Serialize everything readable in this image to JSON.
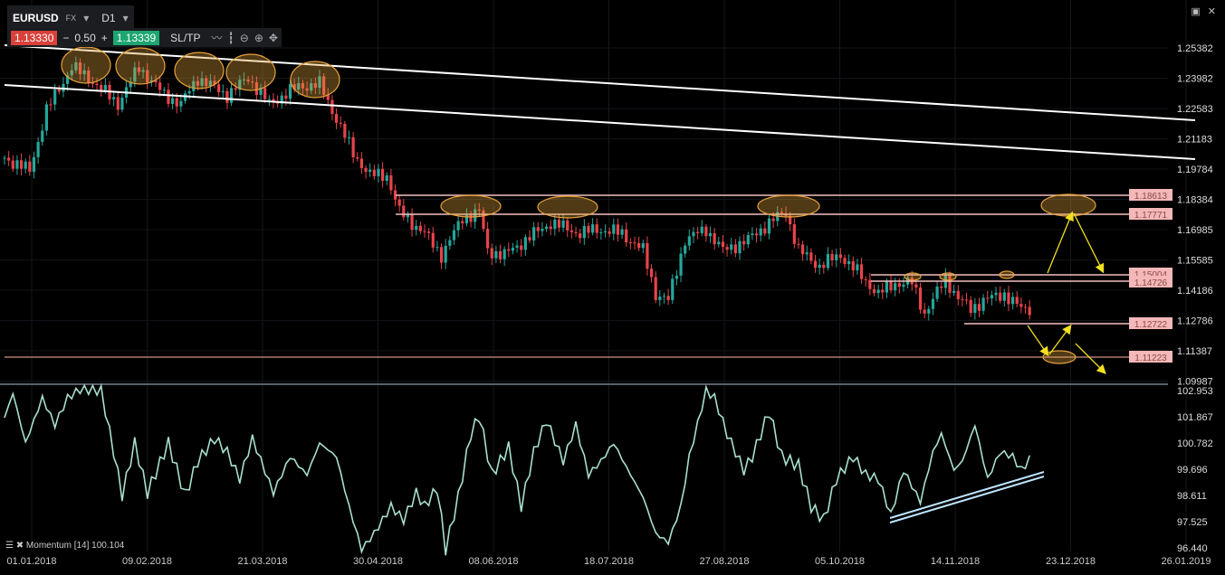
{
  "header": {
    "symbol": "EURUSD",
    "market": "FX",
    "timeframe": "D1",
    "bid": "1.13330",
    "spread_minus": "−",
    "spread": "0.50",
    "spread_plus": "+",
    "ask": "1.13339",
    "sltp": "SL/TP"
  },
  "colors": {
    "bull": "#26a69a",
    "bear": "#e8434a",
    "momentum": "#a8e0d0",
    "label_bg": "#f4b8b8",
    "ellipse": "#e6a23c",
    "arrow": "#f0e020"
  },
  "indicator_legend": "Momentum [14] 100.104",
  "chart_data": [
    {
      "type": "candlestick",
      "title": "EURUSD D1",
      "ylim": [
        1.09987,
        1.25382
      ],
      "y_ticks": [
        "1.25382",
        "1.23982",
        "1.22583",
        "1.21183",
        "1.19784",
        "1.18384",
        "1.16985",
        "1.15585",
        "1.14186",
        "1.12786",
        "1.11387",
        "1.09987"
      ],
      "x_ticks": [
        "01.01.2018",
        "09.02.2018",
        "21.03.2018",
        "30.04.2018",
        "08.06.2018",
        "18.07.2018",
        "27.08.2018",
        "05.10.2018",
        "14.11.2018",
        "23.12.2018",
        "26.01.2019"
      ],
      "n_bars": 245,
      "close_keypoints": [
        [
          0,
          1.203
        ],
        [
          6,
          1.197
        ],
        [
          10,
          1.225
        ],
        [
          16,
          1.245
        ],
        [
          20,
          1.24
        ],
        [
          27,
          1.228
        ],
        [
          32,
          1.245
        ],
        [
          38,
          1.232
        ],
        [
          42,
          1.228
        ],
        [
          46,
          1.24
        ],
        [
          53,
          1.232
        ],
        [
          58,
          1.24
        ],
        [
          63,
          1.228
        ],
        [
          70,
          1.236
        ],
        [
          75,
          1.237
        ],
        [
          78,
          1.225
        ],
        [
          83,
          1.205
        ],
        [
          87,
          1.195
        ],
        [
          91,
          1.195
        ],
        [
          94,
          1.178
        ],
        [
          100,
          1.168
        ],
        [
          104,
          1.158
        ],
        [
          109,
          1.175
        ],
        [
          113,
          1.178
        ],
        [
          115,
          1.16
        ],
        [
          119,
          1.158
        ],
        [
          124,
          1.165
        ],
        [
          130,
          1.173
        ],
        [
          137,
          1.168
        ],
        [
          141,
          1.17
        ],
        [
          147,
          1.168
        ],
        [
          152,
          1.16
        ],
        [
          155,
          1.14
        ],
        [
          158,
          1.137
        ],
        [
          162,
          1.165
        ],
        [
          167,
          1.17
        ],
        [
          171,
          1.16
        ],
        [
          177,
          1.165
        ],
        [
          182,
          1.173
        ],
        [
          186,
          1.178
        ],
        [
          189,
          1.16
        ],
        [
          194,
          1.153
        ],
        [
          199,
          1.158
        ],
        [
          203,
          1.15
        ],
        [
          208,
          1.14
        ],
        [
          212,
          1.145
        ],
        [
          216,
          1.145
        ],
        [
          219,
          1.131
        ],
        [
          224,
          1.147
        ],
        [
          227,
          1.138
        ],
        [
          230,
          1.133
        ],
        [
          233,
          1.137
        ],
        [
          238,
          1.14
        ],
        [
          242,
          1.133
        ],
        [
          244,
          1.1333
        ]
      ],
      "levels": [
        "1.18613",
        "1.17771",
        "1.15004",
        "1.14726",
        "1.12722",
        "1.11223"
      ]
    },
    {
      "type": "line",
      "title": "Momentum [14]",
      "ylim": [
        96.44,
        102.953
      ],
      "y_ticks": [
        "102.953",
        "101.867",
        "100.782",
        "99.696",
        "98.611",
        "97.525",
        "96.440"
      ],
      "keypoints": [
        [
          0,
          101.83
        ],
        [
          2,
          102.84
        ],
        [
          5,
          100.78
        ],
        [
          9,
          102.65
        ],
        [
          12,
          101.53
        ],
        [
          15,
          102.65
        ],
        [
          18,
          103.0
        ],
        [
          23,
          102.95
        ],
        [
          26,
          100.41
        ],
        [
          28,
          98.61
        ],
        [
          31,
          100.78
        ],
        [
          34,
          98.72
        ],
        [
          39,
          100.78
        ],
        [
          43,
          98.61
        ],
        [
          46,
          100.03
        ],
        [
          50,
          100.97
        ],
        [
          53,
          100.41
        ],
        [
          56,
          99.29
        ],
        [
          59,
          100.97
        ],
        [
          64,
          98.72
        ],
        [
          68,
          100.22
        ],
        [
          72,
          99.47
        ],
        [
          75,
          100.78
        ],
        [
          79,
          100.22
        ],
        [
          82,
          98.16
        ],
        [
          85,
          96.37
        ],
        [
          88,
          97.04
        ],
        [
          92,
          98.16
        ],
        [
          95,
          97.6
        ],
        [
          98,
          98.72
        ],
        [
          100,
          98.16
        ],
        [
          103,
          98.91
        ],
        [
          105,
          96.37
        ],
        [
          108,
          98.54
        ],
        [
          111,
          101.16
        ],
        [
          113,
          101.91
        ],
        [
          116,
          99.47
        ],
        [
          120,
          100.6
        ],
        [
          123,
          98.16
        ],
        [
          126,
          100.41
        ],
        [
          129,
          101.72
        ],
        [
          133,
          100.03
        ],
        [
          136,
          101.53
        ],
        [
          139,
          99.47
        ],
        [
          142,
          100.03
        ],
        [
          145,
          100.78
        ],
        [
          149,
          99.47
        ],
        [
          152,
          98.54
        ],
        [
          155,
          97.04
        ],
        [
          158,
          96.66
        ],
        [
          161,
          98.16
        ],
        [
          163,
          100.22
        ],
        [
          167,
          102.95
        ],
        [
          169,
          102.65
        ],
        [
          172,
          101.16
        ],
        [
          176,
          99.66
        ],
        [
          178,
          100.22
        ],
        [
          182,
          102.09
        ],
        [
          185,
          100.22
        ],
        [
          189,
          99.85
        ],
        [
          192,
          98.16
        ],
        [
          195,
          97.6
        ],
        [
          198,
          99.29
        ],
        [
          202,
          100.22
        ],
        [
          205,
          99.47
        ],
        [
          208,
          99.29
        ],
        [
          211,
          97.79
        ],
        [
          214,
          99.66
        ],
        [
          218,
          98.35
        ],
        [
          221,
          100.41
        ],
        [
          223,
          101.16
        ],
        [
          226,
          99.66
        ],
        [
          228,
          100.03
        ],
        [
          231,
          101.53
        ],
        [
          234,
          99.29
        ],
        [
          237,
          100.41
        ],
        [
          240,
          100.22
        ],
        [
          242,
          99.66
        ],
        [
          244,
          100.104
        ]
      ]
    }
  ]
}
